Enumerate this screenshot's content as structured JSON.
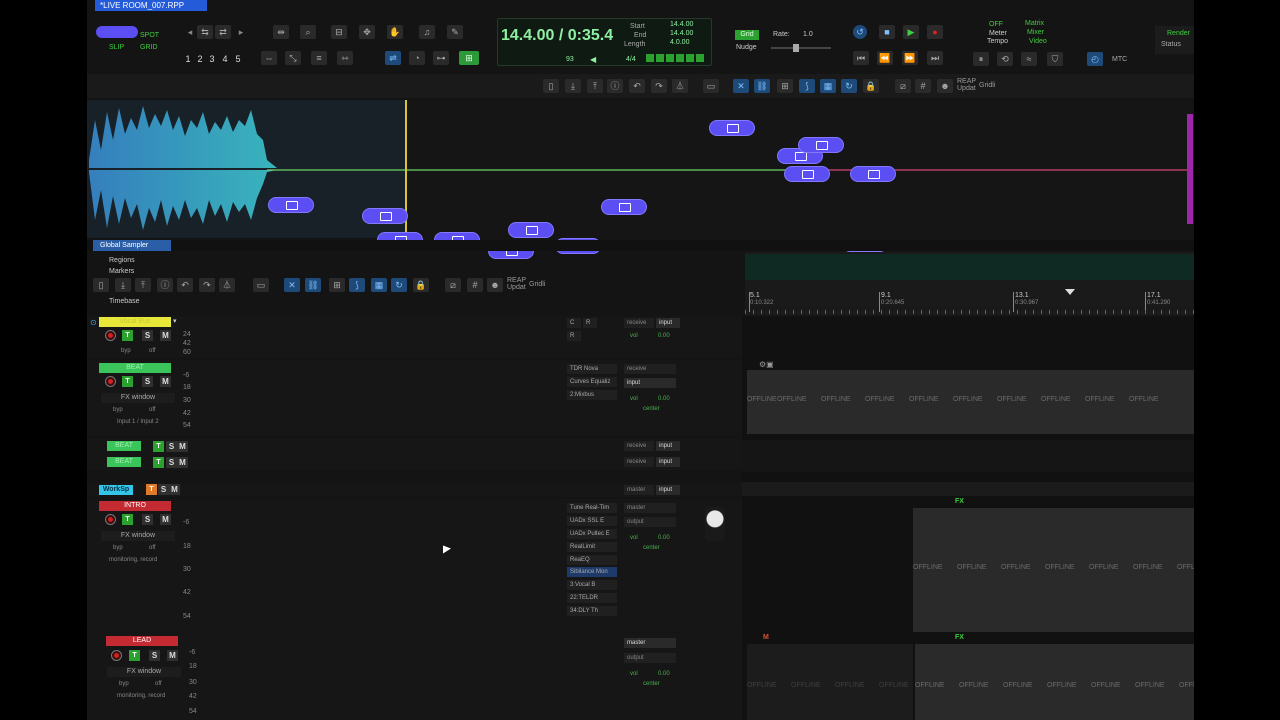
{
  "window": {
    "title": "*LIVE ROOM_007.RPP"
  },
  "toolbar": {
    "mode_spot": "SPOT",
    "mode_slip": "SLIP",
    "mode_grid": "GRID",
    "numbers": [
      "1",
      "2",
      "3",
      "4",
      "5"
    ]
  },
  "transport": {
    "time_display": "14.4.00 / 0:35.4",
    "labels": {
      "start": "Start",
      "end": "End",
      "length": "Length"
    },
    "values": {
      "start": "14.4.00",
      "end": "14.4.00",
      "length": "4.0.00"
    },
    "bpm": "93",
    "time_sig": "4/4"
  },
  "grid_panel": {
    "grid": "Grid",
    "rate_label": "Rate:",
    "rate_value": "1.0",
    "nudge": "Nudge"
  },
  "status_panel": {
    "off": "OFF",
    "meter": "Meter",
    "tempo": "Tempo",
    "matrix": "Matrix",
    "mixer": "Mixer",
    "video": "Video",
    "mtc": "MTC",
    "render": "Render",
    "status": "Status"
  },
  "sampler": {
    "title": "Global Sampler"
  },
  "track_header": {
    "regions": "Regions",
    "markers": "Markers",
    "timebase": "Timebase",
    "reap_updat": "REAP Updat",
    "gridli": "Gridli"
  },
  "ruler": {
    "marks": [
      {
        "bar": "5.1",
        "time": "0:10.322"
      },
      {
        "bar": "9.1",
        "time": "0:20.645"
      },
      {
        "bar": "13.1",
        "time": "0:30.967"
      },
      {
        "bar": "17.1",
        "time": "0:41.290"
      }
    ]
  },
  "tracks": [
    {
      "name": "Vocal Bus",
      "color": "#e8e83a",
      "fx": [
        "C",
        "R",
        "R"
      ],
      "receive": "receive",
      "input": "input",
      "vol": "0.00",
      "scale": [
        "24",
        "42",
        "60"
      ]
    },
    {
      "name": "BEAT",
      "color": "#3bc45a",
      "fx": [
        "TDR Nova",
        "Curves Equaliz",
        "2:Mixbus"
      ],
      "receive": "receive",
      "input": "input",
      "vol": "0.00",
      "pan": "center",
      "fx_window": "FX window",
      "byp": "byp",
      "off": "off",
      "io": "Input 1 / Input 2",
      "scale": [
        "-6",
        "18",
        "30",
        "42",
        "54"
      ]
    },
    {
      "name": "BEAT",
      "color": "#3bc45a",
      "receive": "receive",
      "input": "input"
    },
    {
      "name": "BEAT",
      "color": "#3bc45a",
      "receive": "receive",
      "input": "input"
    },
    {
      "name": "WorkSp",
      "color": "#34c6e6",
      "master": "master",
      "input": "input"
    },
    {
      "name": "INTRO",
      "color": "#c42a32",
      "fx": [
        "Tune Real-Tim",
        "UADx SSL E",
        "UADx Pultec E",
        "RealLimit",
        "ReaEQ",
        "Sibilance Mon",
        "3:Vocal B",
        "22:TELDR",
        "34:DLY Th"
      ],
      "master": "master",
      "output": "output",
      "vol": "0.00",
      "pan": "center",
      "fx_window": "FX window",
      "byp": "byp",
      "off": "off",
      "io": "monitoring, record",
      "scale": [
        "-6",
        "18",
        "30",
        "42",
        "54"
      ]
    },
    {
      "name": "LEAD",
      "color": "#c42a32",
      "master": "master",
      "output": "output",
      "vol": "0.00",
      "pan": "center",
      "fx_window": "FX window",
      "byp": "byp",
      "off": "off",
      "io": "monitoring, record",
      "scale": [
        "-6",
        "18",
        "30",
        "42",
        "54"
      ]
    }
  ],
  "buttons": {
    "r": "R",
    "s": "S",
    "m": "M",
    "t": "T",
    "fx": "FX"
  },
  "offline_text": "OFFLINE",
  "colors": {
    "purple": "#5b4ef2",
    "accent_green": "#2ba12f",
    "wave": "#3ecfd6",
    "time_display": "#8ef0a2"
  }
}
